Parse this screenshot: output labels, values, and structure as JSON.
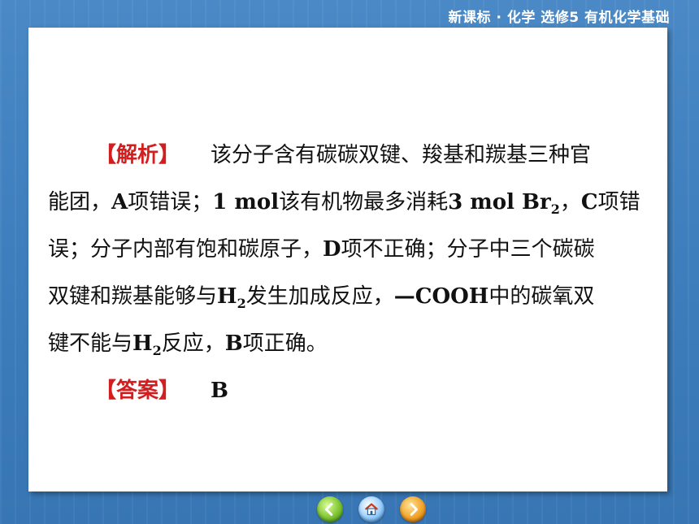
{
  "header": {
    "title": "新课标 · 化学  选修5  有机化学基础"
  },
  "analysis": {
    "tag": "【解析】",
    "line1": "该分子含有碳碳双键、羧基和羰基三种官",
    "line2_a": "能团，",
    "line2_b": "A",
    "line2_c": "项错误；",
    "line2_d": "1 mol",
    "line2_e": "该有机物最多消耗",
    "line2_f": "3 mol Br",
    "line2_sub": "2",
    "line2_g": "，",
    "line2_h": "C",
    "line2_i": "项错",
    "line3_a": "误；分子内部有饱和碳原子，",
    "line3_b": "D",
    "line3_c": "项不正确；分子中三个碳碳",
    "line4_a": "双键和羰基能够与",
    "line4_b": "H",
    "line4_sub": "2",
    "line4_c": "发生加成反应，",
    "line4_d": "—COOH",
    "line4_e": "中的碳氧双",
    "line5_a": "键不能与",
    "line5_b": "H",
    "line5_sub": "2",
    "line5_c": "反应，",
    "line5_d": "B",
    "line5_e": "项正确。"
  },
  "answer": {
    "tag": "【答案】",
    "value": "B"
  },
  "nav": {
    "icons": [
      "back-arrow-icon",
      "home-icon",
      "forward-arrow-icon"
    ]
  },
  "colors": {
    "background": "#3f7fbd",
    "tag_red": "#d21e1e",
    "slide": "#ffffff"
  }
}
